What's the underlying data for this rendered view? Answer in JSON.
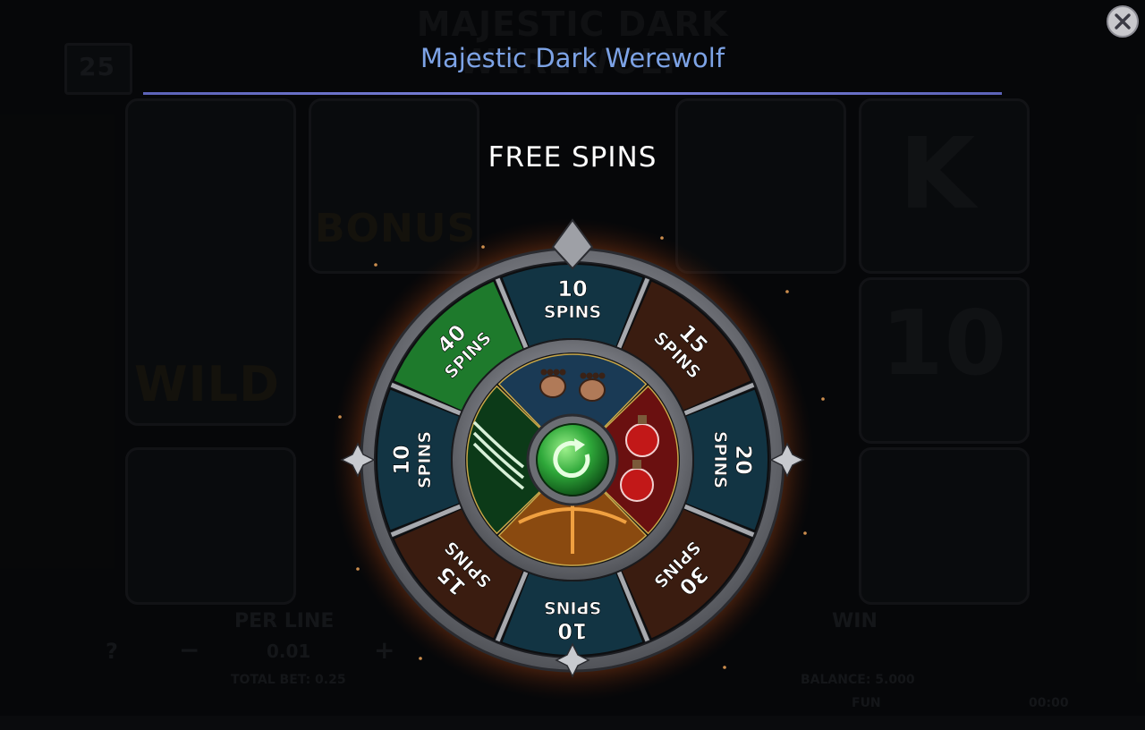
{
  "game": {
    "title": "Majestic Dark Werewolf",
    "bg_logo": "MAJESTIC DARK WEREWOLF",
    "lines": "25"
  },
  "modal": {
    "heading": "FREE SPINS",
    "close_icon": "close-icon"
  },
  "wheel": {
    "outer_segments": [
      {
        "label_top": "10",
        "label_bottom": "SPINS",
        "color": "#123443"
      },
      {
        "label_top": "15",
        "label_bottom": "SPINS",
        "color": "#3a1c10"
      },
      {
        "label_top": "20",
        "label_bottom": "SPINS",
        "color": "#123443"
      },
      {
        "label_top": "30",
        "label_bottom": "SPINS",
        "color": "#3a1c10"
      },
      {
        "label_top": "10",
        "label_bottom": "SPINS",
        "color": "#123443"
      },
      {
        "label_top": "15",
        "label_bottom": "SPINS",
        "color": "#3a1c10"
      },
      {
        "label_top": "10",
        "label_bottom": "SPINS",
        "color": "#123443"
      },
      {
        "label_top": "40",
        "label_bottom": "SPINS",
        "color": "#1e7a2c"
      }
    ],
    "inner_segments": [
      {
        "name": "paw-prints",
        "color": "#1a3a55"
      },
      {
        "name": "potions",
        "color": "#6a1010"
      },
      {
        "name": "crossbow",
        "color": "#8a4a10"
      },
      {
        "name": "claw-slash",
        "color": "#0c3a18"
      }
    ],
    "center_button_icon": "spin-arrow-icon",
    "glow_color": "#e06a1e",
    "rim_color": "#8e9096"
  },
  "bg_bottom": {
    "per_line_label": "PER LINE",
    "per_line_value": "0.01",
    "win_label": "WIN",
    "total_bet": "TOTAL BET: 0.25",
    "balance": "BALANCE: 5.000",
    "fun": "FUN",
    "time": "00:00",
    "help": "?",
    "minus": "−",
    "plus": "+"
  },
  "bg_symbols": {
    "wild": "WILD",
    "bonus": "BONUS",
    "k": "K",
    "ten": "10"
  }
}
